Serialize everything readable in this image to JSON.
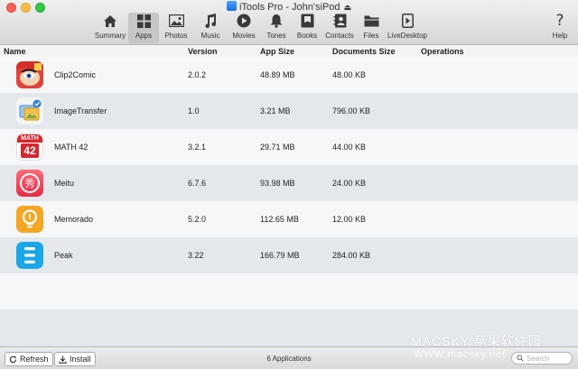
{
  "window": {
    "title": "iTools Pro - John'siPod",
    "eject_icon": "eject-icon"
  },
  "toolbar": {
    "items": [
      {
        "label": "Summary",
        "icon": "home-icon"
      },
      {
        "label": "Apps",
        "icon": "apps-grid-icon",
        "active": true
      },
      {
        "label": "Photos",
        "icon": "photo-icon"
      },
      {
        "label": "Music",
        "icon": "music-note-icon"
      },
      {
        "label": "Movies",
        "icon": "play-circle-icon"
      },
      {
        "label": "Tones",
        "icon": "bell-icon"
      },
      {
        "label": "Books",
        "icon": "book-icon"
      },
      {
        "label": "Contacts",
        "icon": "contacts-book-icon"
      },
      {
        "label": "Files",
        "icon": "folder-icon"
      },
      {
        "label": "LiveDesktop",
        "icon": "live-desktop-icon"
      },
      {
        "label": "Help",
        "icon": "question-mark-icon"
      }
    ]
  },
  "table": {
    "headers": [
      "Name",
      "Version",
      "App Size",
      "Documents Size",
      "Operations"
    ],
    "rows": [
      {
        "name": "Clip2Comic",
        "version": "2.0.2",
        "app_size": "48.89 MB",
        "doc_size": "48.00 KB",
        "icon": "clip2comic-app-icon"
      },
      {
        "name": "ImageTransfer",
        "version": "1.0",
        "app_size": "3.21 MB",
        "doc_size": "796.00 KB",
        "icon": "imagetransfer-app-icon"
      },
      {
        "name": "MATH 42",
        "version": "3.2.1",
        "app_size": "29.71 MB",
        "doc_size": "44.00 KB",
        "icon": "math42-app-icon",
        "icon_text_top": "MATH",
        "icon_text_num": "42"
      },
      {
        "name": "Meitu",
        "version": "6.7.6",
        "app_size": "93.98 MB",
        "doc_size": "24.00 KB",
        "icon": "meitu-app-icon",
        "icon_text": "秀"
      },
      {
        "name": "Memorado",
        "version": "5.2.0",
        "app_size": "112.65 MB",
        "doc_size": "12.00 KB",
        "icon": "memorado-app-icon"
      },
      {
        "name": "Peak",
        "version": "3.22",
        "app_size": "166.79 MB",
        "doc_size": "284.00 KB",
        "icon": "peak-app-icon"
      }
    ]
  },
  "bottom": {
    "refresh_label": "Refresh",
    "install_label": "Install",
    "status": "6 Applications",
    "search_placeholder": "Search"
  },
  "watermark": {
    "text": "MACSKY 苹果软件园",
    "url": "WWW.macsky.net"
  },
  "colors": {
    "row_alt": "#e4e8ec",
    "row_plain": "#f7f7f7",
    "active_tab": "#c6c6c6"
  }
}
